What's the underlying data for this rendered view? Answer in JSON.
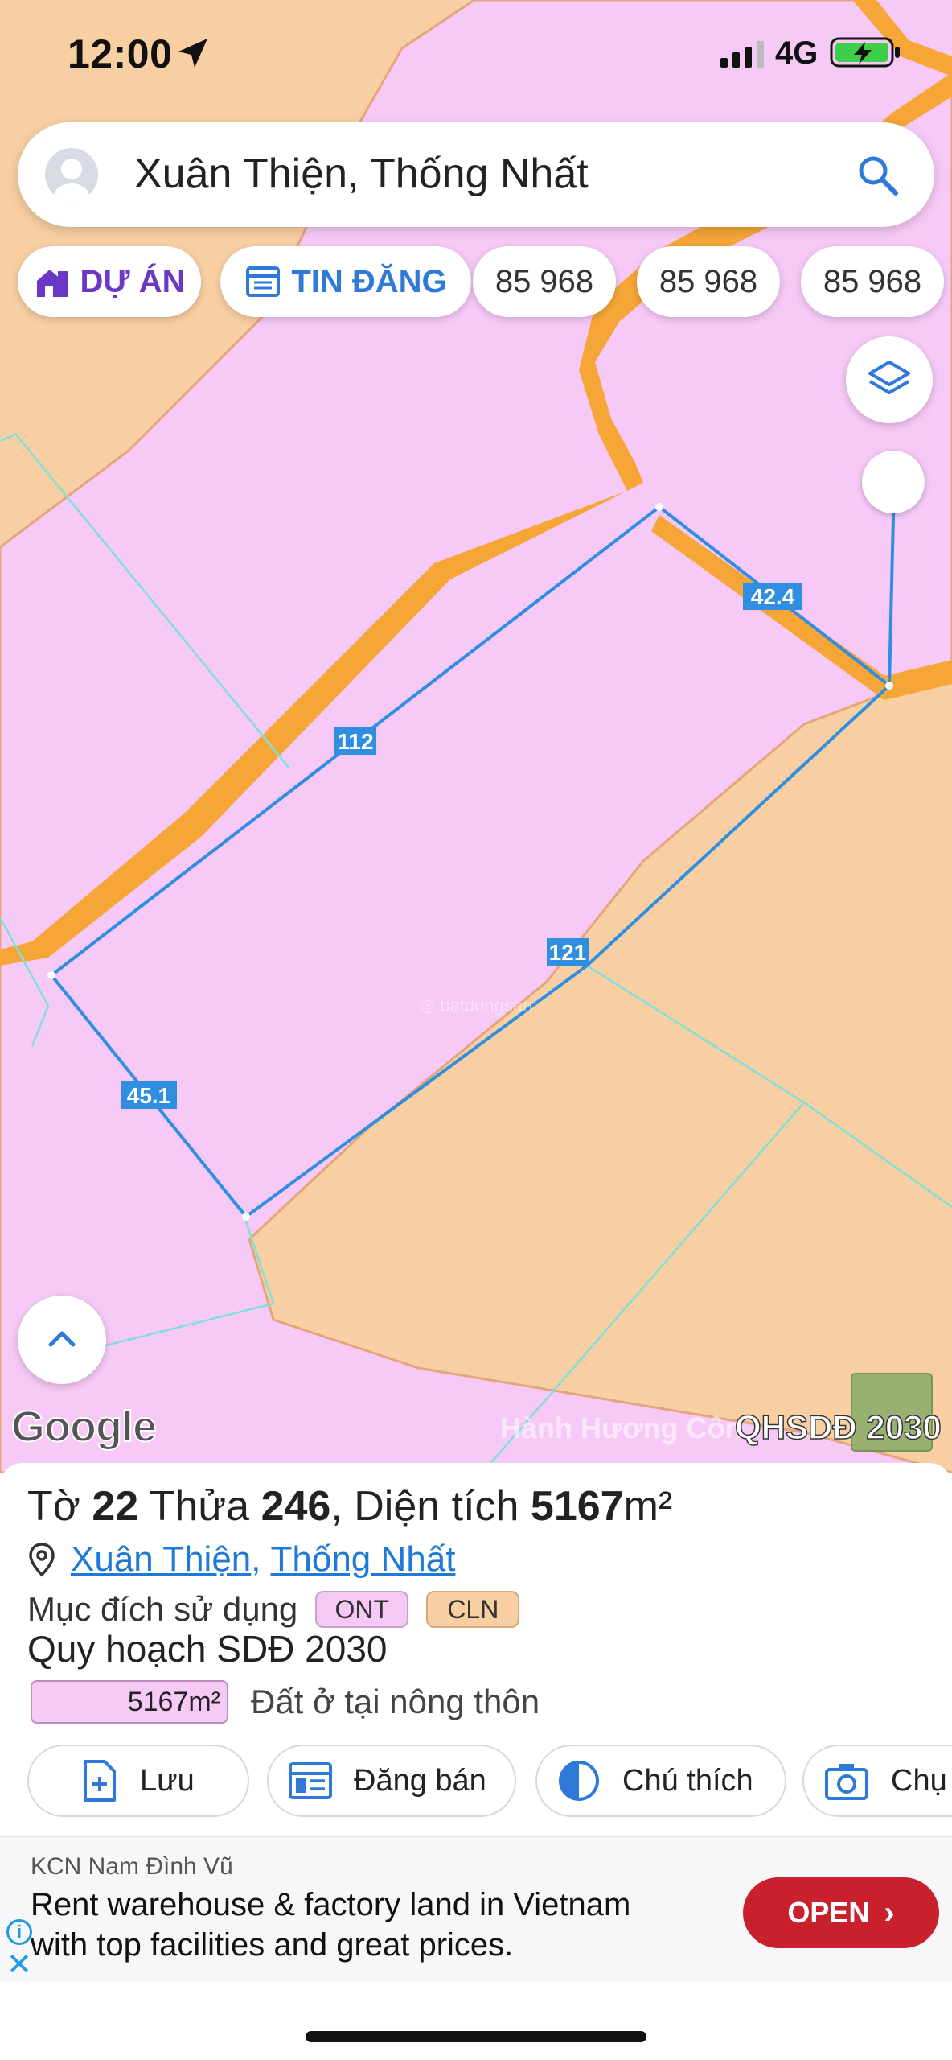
{
  "status_bar": {
    "time": "12:00",
    "network": "4G",
    "icons": [
      "location-arrow-icon",
      "signal-icon",
      "battery-charging-icon"
    ]
  },
  "search": {
    "location_text": "Xuân Thiện, Thống Nhất",
    "icons": [
      "avatar-icon",
      "search-icon"
    ]
  },
  "chips": {
    "project": "DỰ ÁN",
    "listing": "TIN ĐĂNG",
    "numbers": [
      "85 968",
      "85 968",
      "85 968"
    ]
  },
  "map": {
    "edge_lengths": {
      "north": "112",
      "northeast": "42.4",
      "southeast": "121",
      "west": "45.1"
    },
    "google_logo": "Google",
    "watermark": "Hành Hương Côn",
    "plan_layer": "QHSDĐ 2030",
    "colors": {
      "residential": "#f7c9f7",
      "perennial": "#f8cfa2",
      "road": "#f5a637",
      "parcel_outline": "#2f8ee0",
      "boundary": "#7fe0d9"
    }
  },
  "parcel": {
    "sheet_label": "Tờ",
    "sheet": "22",
    "plot_label": "Thửa",
    "plot": "246",
    "area_label": "Diện tích",
    "area_value": "5167",
    "area_unit": "m²",
    "commune": "Xuân Thiện",
    "district": "Thống Nhất",
    "purpose_label": "Mục đích sử dụng",
    "purposes": [
      "ONT",
      "CLN"
    ],
    "plan_title": "Quy hoạch SDĐ 2030",
    "legend_area": "5167m²",
    "legend_desc": "Đất ở tại nông thôn"
  },
  "actions": {
    "save": "Lưu",
    "post": "Đăng bán",
    "legend": "Chú thích",
    "capture": "Chụ"
  },
  "ad": {
    "source": "KCN Nam Đình Vũ",
    "line1": "Rent warehouse & factory land in Vietnam",
    "line2": "with top facilities and great prices.",
    "open": "OPEN",
    "accent": "#c8202d"
  }
}
